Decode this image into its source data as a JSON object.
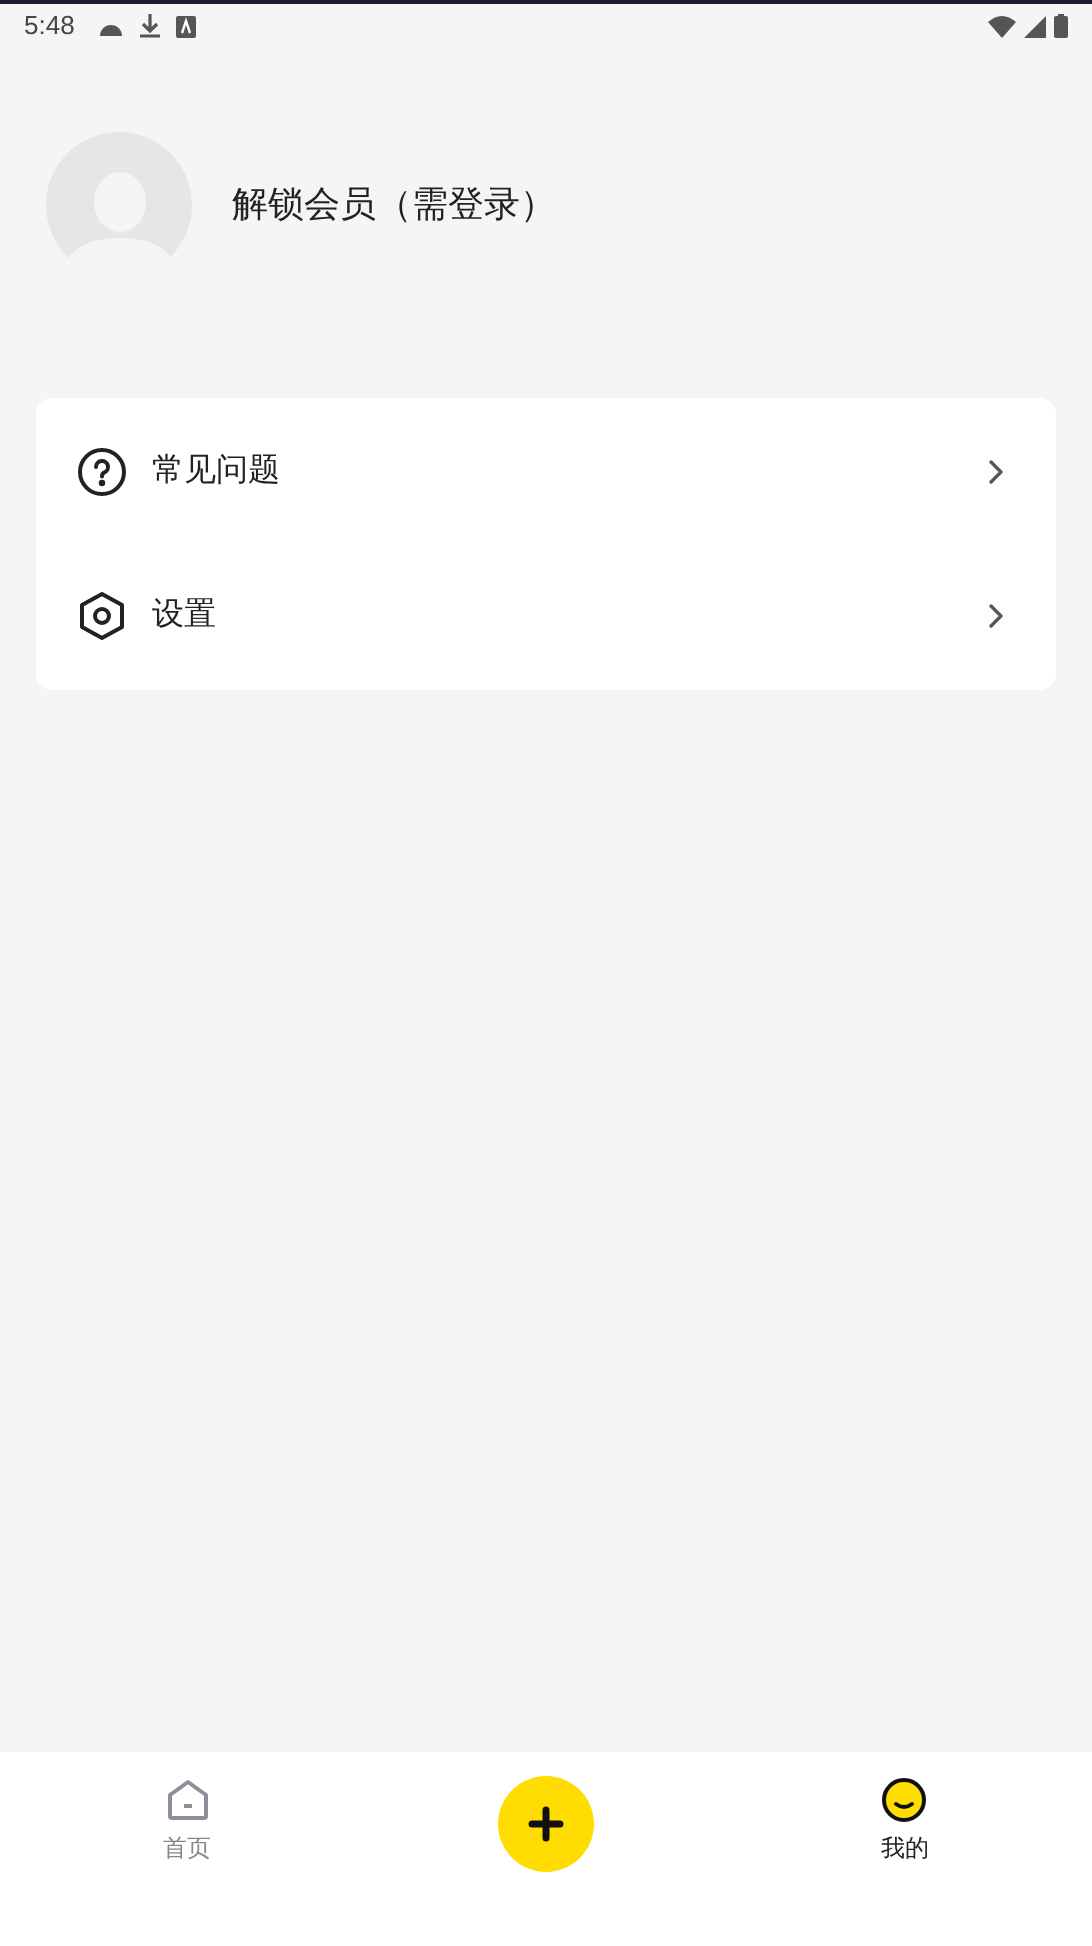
{
  "status_bar": {
    "time": "5:48"
  },
  "profile": {
    "title": "解锁会员（需登录）"
  },
  "menu": [
    {
      "kind": "help",
      "label": "常见问题"
    },
    {
      "kind": "settings",
      "label": "设置"
    }
  ],
  "nav": [
    {
      "kind": "home",
      "label": "首页",
      "selected": false
    },
    {
      "kind": "add"
    },
    {
      "kind": "me",
      "label": "我的",
      "selected": true
    }
  ]
}
